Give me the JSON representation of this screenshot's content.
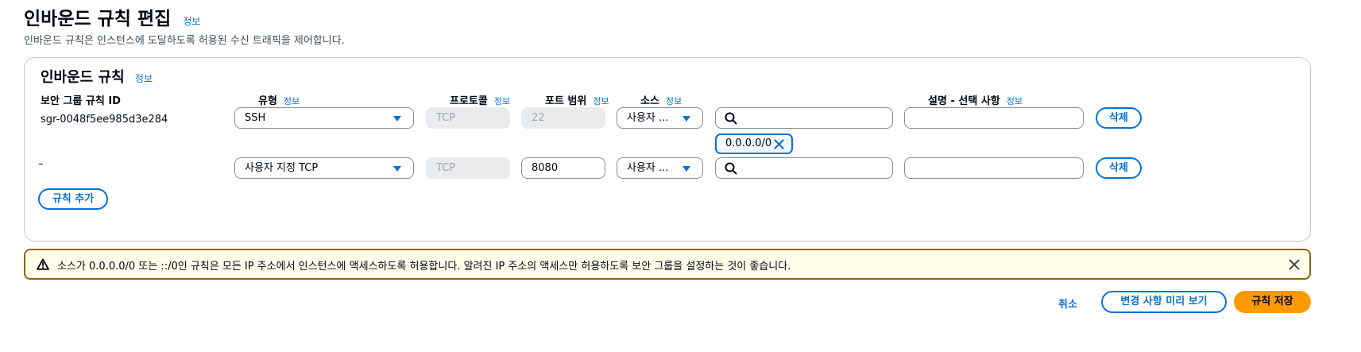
{
  "header": {
    "title": "인바운드 규칙 편집",
    "info": "정보",
    "description": "인바운드 규칙은 인스턴스에 도달하도록 허용된 수신 트래픽을 제어합니다."
  },
  "panel": {
    "title": "인바운드 규칙",
    "info": "정보",
    "columns": {
      "rule_id": "보안 그룹 규칙 ID",
      "type": "유형",
      "protocol": "프로토콜",
      "port_range": "포트 범위",
      "source": "소스",
      "description": "설명 - 선택 사항",
      "info": "정보"
    },
    "rows": [
      {
        "rule_id": "sgr-0048f5ee985d3e284",
        "type": "SSH",
        "protocol": "TCP",
        "port": "22",
        "source": "사용자 ...",
        "source_search": "",
        "cidr_token": "0.0.0.0/0",
        "description": "",
        "delete": "삭제"
      },
      {
        "rule_id": "–",
        "type": "사용자 지정 TCP",
        "protocol": "TCP",
        "port": "8080",
        "source": "사용자 ...",
        "source_search": "",
        "description": "",
        "delete": "삭제"
      }
    ],
    "add_rule": "규칙 추가"
  },
  "warning": {
    "text": "소스가 0.0.0.0/0 또는 ::/0인 규칙은 모든 IP 주소에서 인스턴스에 액세스하도록 허용합니다. 알려진 IP 주소의 액세스만 허용하도록 보안 그룹을 설정하는 것이 좋습니다."
  },
  "footer": {
    "cancel": "취소",
    "preview": "변경 사항 미리 보기",
    "save": "규칙 저장"
  },
  "colors": {
    "accent": "#0972d3",
    "primary": "#ff9900",
    "warning_border": "#8d6605",
    "warning_bg": "#fffce9"
  }
}
